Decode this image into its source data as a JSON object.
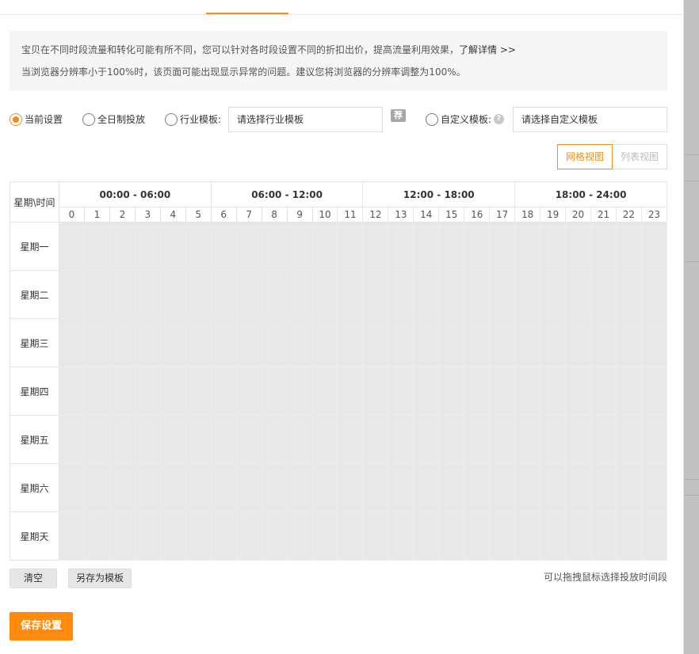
{
  "notice": {
    "line1": "宝贝在不同时段流量和转化可能有所不同，您可以针对各时段设置不同的折扣出价，提高流量利用效果，",
    "learn_more": "了解详情 >>",
    "line2": "当浏览器分辨率小于100%时，该页面可能出现显示异常的问题。建议您将浏览器的分辨率调整为100%。"
  },
  "modes": {
    "current": "当前设置",
    "allday": "全日制投放",
    "industry": "行业模板:",
    "industry_placeholder": "请选择行业模板",
    "recommend_badge": "荐",
    "custom": "自定义模板:",
    "help_icon": "?",
    "custom_placeholder": "请选择自定义模板",
    "selected": "current"
  },
  "views": {
    "grid": "网格视图",
    "list": "列表视图",
    "active": "grid"
  },
  "schedule": {
    "corner_label": "星期\\时间",
    "ranges": [
      "00:00 - 06:00",
      "06:00 - 12:00",
      "12:00 - 18:00",
      "18:00 - 24:00"
    ],
    "hours": [
      "0",
      "1",
      "2",
      "3",
      "4",
      "5",
      "6",
      "7",
      "8",
      "9",
      "10",
      "11",
      "12",
      "13",
      "14",
      "15",
      "16",
      "17",
      "18",
      "19",
      "20",
      "21",
      "22",
      "23"
    ],
    "days": [
      "星期一",
      "星期二",
      "星期三",
      "星期四",
      "星期五",
      "星期六",
      "星期天"
    ],
    "cell_color": "#e8e8e8"
  },
  "actions": {
    "clear": "清空",
    "save_as_template": "另存为模板",
    "drag_hint": "可以拖拽鼠标选择投放时间段",
    "save": "保存设置"
  },
  "colors": {
    "accent": "#f08c1e",
    "save_button": "#ff8a0d"
  }
}
